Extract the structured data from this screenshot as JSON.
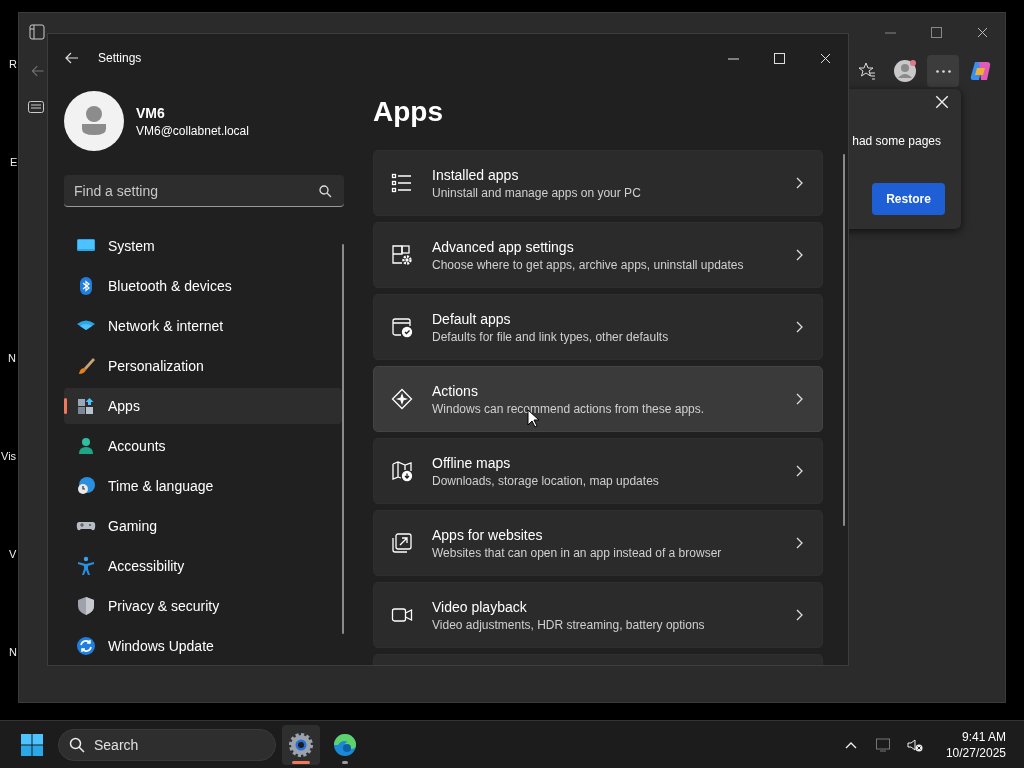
{
  "desktop": {
    "icon_labels": [
      "R",
      "E",
      "N",
      "Vis",
      "V",
      "N"
    ]
  },
  "browser": {
    "notice": {
      "text": "had some pages",
      "button": "Restore"
    }
  },
  "settings": {
    "window_title": "Settings",
    "profile": {
      "name": "VM6",
      "email": "VM6@collabnet.local"
    },
    "search": {
      "placeholder": "Find a setting"
    },
    "nav": [
      {
        "label": "System",
        "kind": "system",
        "selected": false
      },
      {
        "label": "Bluetooth & devices",
        "kind": "bluetooth",
        "selected": false
      },
      {
        "label": "Network & internet",
        "kind": "network",
        "selected": false
      },
      {
        "label": "Personalization",
        "kind": "personalization",
        "selected": false
      },
      {
        "label": "Apps",
        "kind": "apps",
        "selected": true
      },
      {
        "label": "Accounts",
        "kind": "accounts",
        "selected": false
      },
      {
        "label": "Time & language",
        "kind": "time",
        "selected": false
      },
      {
        "label": "Gaming",
        "kind": "gaming",
        "selected": false
      },
      {
        "label": "Accessibility",
        "kind": "accessibility",
        "selected": false
      },
      {
        "label": "Privacy & security",
        "kind": "privacy",
        "selected": false
      },
      {
        "label": "Windows Update",
        "kind": "update",
        "selected": false
      }
    ],
    "page_title": "Apps",
    "cards": [
      {
        "title": "Installed apps",
        "subtitle": "Uninstall and manage apps on your PC",
        "kind": "list",
        "hovered": false
      },
      {
        "title": "Advanced app settings",
        "subtitle": "Choose where to get apps, archive apps, uninstall updates",
        "kind": "advanced",
        "hovered": false
      },
      {
        "title": "Default apps",
        "subtitle": "Defaults for file and link types, other defaults",
        "kind": "default",
        "hovered": false
      },
      {
        "title": "Actions",
        "subtitle": "Windows can recommend actions from these apps.",
        "kind": "actions",
        "hovered": true
      },
      {
        "title": "Offline maps",
        "subtitle": "Downloads, storage location, map updates",
        "kind": "map",
        "hovered": false
      },
      {
        "title": "Apps for websites",
        "subtitle": "Websites that can open in an app instead of a browser",
        "kind": "websites",
        "hovered": false
      },
      {
        "title": "Video playback",
        "subtitle": "Video adjustments, HDR streaming, battery options",
        "kind": "video",
        "hovered": false
      }
    ]
  },
  "taskbar": {
    "search": {
      "placeholder": "Search"
    },
    "apps": [
      {
        "kind": "settings",
        "active": true
      },
      {
        "kind": "edge",
        "active": false
      }
    ],
    "time": "9:41 AM",
    "date": "10/27/2025"
  }
}
